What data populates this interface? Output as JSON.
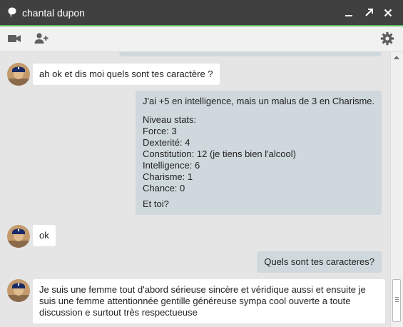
{
  "window": {
    "title": "chantal dupon"
  },
  "messages": {
    "m1": "ah ok et dis moi quels sont tes caractère ?",
    "m2": {
      "intro": "J'ai +5 en intelligence, mais un malus de 3 en Charisme.",
      "stats_header": "Niveau stats:",
      "stats": [
        "Force: 3",
        "Dexterité: 4",
        "Constitution: 12 (je tiens bien l'alcool)",
        "Intelligence: 6",
        "Charisme: 1",
        "Chance: 0"
      ],
      "outro": "Et toi?"
    },
    "m3": "ok",
    "m4": "Quels sont tes caracteres?",
    "m5": [
      "Je suis une femme tout d'abord sérieuse sincère et véridique aussi et ensuite je",
      "suis une femme attentionnée gentille généreuse sympa cool ouverte a toute",
      "discussion e surtout très respectueuse"
    ]
  },
  "colors": {
    "titlebar": "#404040",
    "accent": "#5cb85c",
    "outgoing_bubble": "#cfd8dc",
    "incoming_bubble": "#ffffff",
    "chat_background": "#e5e5e5"
  },
  "icons": [
    "chat-bubble-icon",
    "minimize-icon",
    "popout-icon",
    "close-icon",
    "video-call-icon",
    "add-person-icon",
    "settings-gear-icon",
    "avatar"
  ]
}
